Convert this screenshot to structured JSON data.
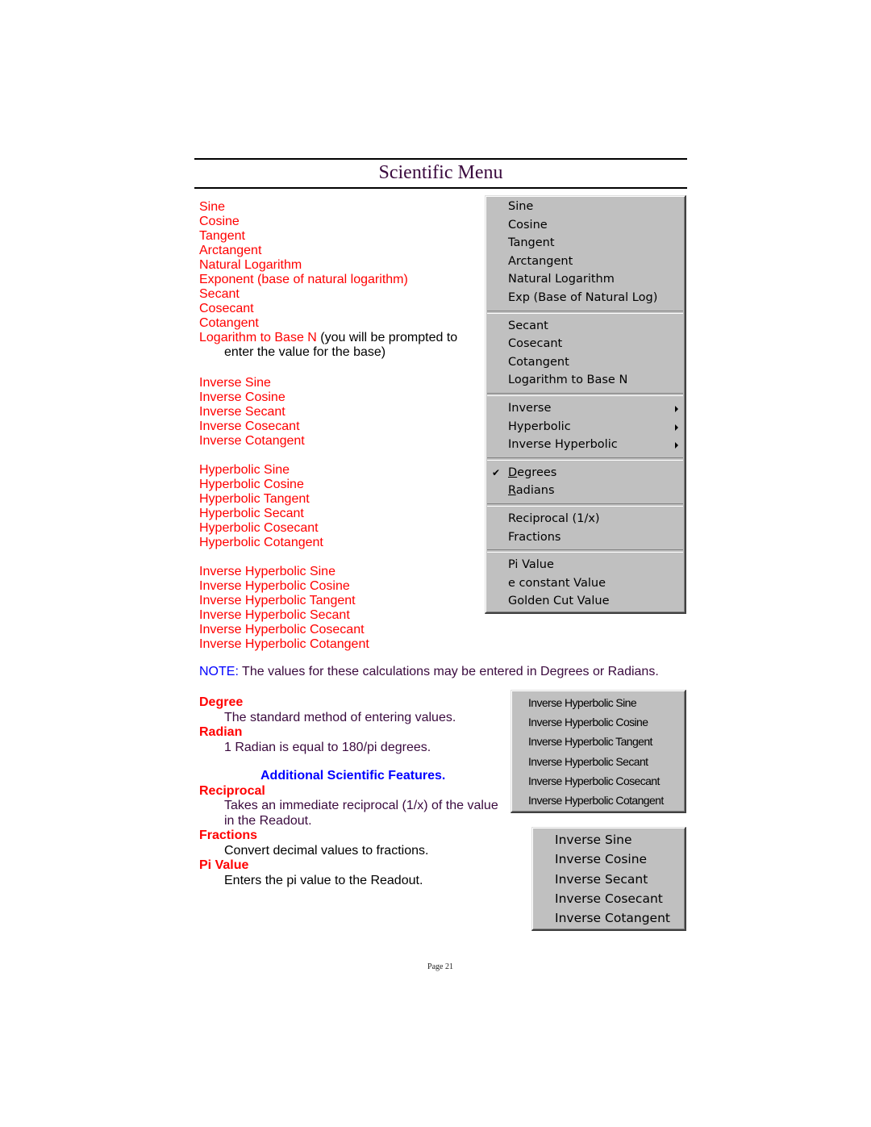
{
  "header": {
    "title": "Scientific Menu"
  },
  "function_list": {
    "group1": [
      "Sine",
      "Cosine",
      "Tangent",
      "Arctangent",
      "Natural Logarithm",
      "Exponent (base of natural logarithm)",
      "Secant",
      "Cosecant",
      "Cotangent"
    ],
    "log_base_n": {
      "label": "Logarithm to Base N",
      "note": " (you will be prompted to",
      "note_cont": "enter the value for the base)"
    },
    "inverse": [
      "Inverse Sine",
      "Inverse Cosine",
      "Inverse Secant",
      "Inverse Cosecant",
      "Inverse Cotangent"
    ],
    "hyperbolic": [
      "Hyperbolic Sine",
      "Hyperbolic Cosine",
      "Hyperbolic Tangent",
      "Hyperbolic Secant",
      "Hyperbolic Cosecant",
      "Hyperbolic Cotangent"
    ],
    "inverse_hyperbolic": [
      "Inverse Hyperbolic Sine",
      "Inverse Hyperbolic Cosine",
      "Inverse Hyperbolic Tangent",
      "Inverse Hyperbolic Secant",
      "Inverse Hyperbolic Cosecant",
      "Inverse Hyperbolic Cotangent"
    ]
  },
  "note": {
    "label": "NOTE:",
    "text": " The values for these calculations may be entered in Degrees or Radians."
  },
  "features": {
    "degree": {
      "head": "Degree",
      "desc": "The standard method of entering values."
    },
    "radian": {
      "head": "Radian",
      "desc": "1 Radian is equal to 180/pi degrees."
    },
    "section_title": "Additional Scientific Features.",
    "reciprocal": {
      "head": "Reciprocal",
      "desc1": "Takes an immediate reciprocal (1/x) of  the value",
      "desc2": "in the Readout."
    },
    "fractions": {
      "head": "Fractions",
      "desc": "Convert decimal values to fractions."
    },
    "pi_value": {
      "head": "Pi Value",
      "desc": "Enters the pi value to the Readout."
    }
  },
  "main_menu": {
    "section1": [
      "Sine",
      "Cosine",
      "Tangent",
      "Arctangent",
      "Natural Logarithm",
      "Exp (Base of Natural Log)"
    ],
    "section2": [
      "Secant",
      "Cosecant",
      "Cotangent",
      "Logarithm to Base N"
    ],
    "submenus": [
      "Inverse",
      "Hyperbolic",
      "Inverse Hyperbolic"
    ],
    "angle_mode": {
      "degrees": {
        "mnemonic": "D",
        "rest": "egrees",
        "checked": true,
        "check_icon": "✔"
      },
      "radians": {
        "mnemonic": "R",
        "rest": "adians",
        "checked": false
      }
    },
    "section4": [
      "Reciprocal (1/x)",
      "Fractions"
    ],
    "section5": [
      "Pi Value",
      "e constant Value",
      "Golden Cut Value"
    ]
  },
  "inverse_hyperbolic_menu": [
    "Inverse Hyperbolic Sine",
    "Inverse Hyperbolic Cosine",
    "Inverse Hyperbolic Tangent",
    "Inverse Hyperbolic Secant",
    "Inverse Hyperbolic Cosecant",
    "Inverse Hyperbolic Cotangent"
  ],
  "inverse_menu": [
    "Inverse Sine",
    "Inverse Cosine",
    "Inverse Secant",
    "Inverse Cosecant",
    "Inverse Cotangent"
  ],
  "footer": {
    "page": "Page 21"
  }
}
